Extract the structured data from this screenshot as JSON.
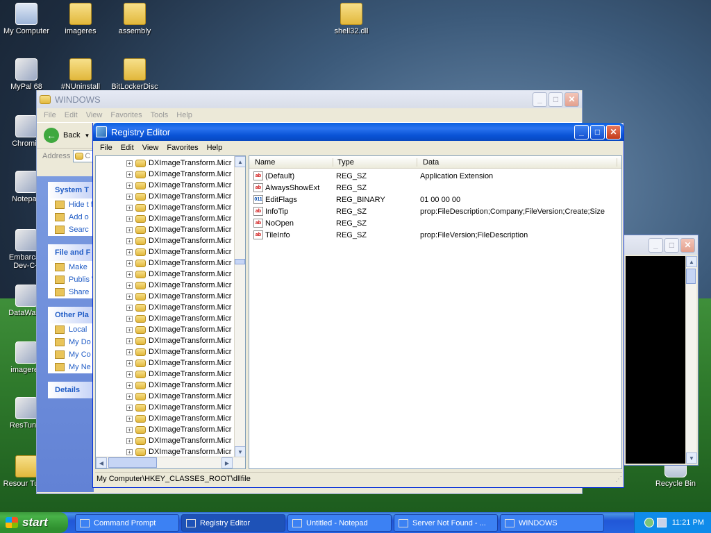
{
  "desktop": {
    "icons": [
      {
        "label": "My Computer",
        "kind": "computer"
      },
      {
        "label": "imageres",
        "kind": "folder"
      },
      {
        "label": "assembly",
        "kind": "folder"
      },
      {
        "label": "shell32.dll",
        "kind": "folder"
      },
      {
        "label": "MyPal 68",
        "kind": "app"
      },
      {
        "label": "#NUninstall",
        "kind": "folder"
      },
      {
        "label": "BitLockerDisc",
        "kind": "folder"
      },
      {
        "label": "Chromiu",
        "kind": "app"
      },
      {
        "label": "Notepad",
        "kind": "app"
      },
      {
        "label": "Embarcad Dev-C+",
        "kind": "app"
      },
      {
        "label": "DataWago",
        "kind": "app"
      },
      {
        "label": "imageres",
        "kind": "app"
      },
      {
        "label": "ResTuner",
        "kind": "app"
      },
      {
        "label": "Resour Tuner",
        "kind": "folder"
      },
      {
        "label": "Recycle Bin",
        "kind": "bin"
      }
    ]
  },
  "explorer": {
    "title": "WINDOWS",
    "menu": [
      "File",
      "Edit",
      "View",
      "Favorites",
      "Tools",
      "Help"
    ],
    "back_label": "Back",
    "address_label": "Address",
    "address_value": "C",
    "panels": [
      {
        "title": "System T",
        "items": [
          "Hide t folder",
          "Add o",
          "Searc"
        ]
      },
      {
        "title": "File and F",
        "items": [
          "Make",
          "Publis Web",
          "Share"
        ]
      },
      {
        "title": "Other Pla",
        "items": [
          "Local",
          "My Do",
          "My Co",
          "My Ne"
        ]
      },
      {
        "title": "Details",
        "items": []
      }
    ]
  },
  "regedit": {
    "title": "Registry Editor",
    "menu": [
      "File",
      "Edit",
      "View",
      "Favorites",
      "Help"
    ],
    "tree_item": "DXImageTransform.Micr",
    "tree_count": 27,
    "columns": [
      "Name",
      "Type",
      "Data"
    ],
    "values": [
      {
        "name": "(Default)",
        "type": "REG_SZ",
        "data": "Application Extension",
        "icon": "ab"
      },
      {
        "name": "AlwaysShowExt",
        "type": "REG_SZ",
        "data": "",
        "icon": "ab"
      },
      {
        "name": "EditFlags",
        "type": "REG_BINARY",
        "data": "01 00 00 00",
        "icon": "bin"
      },
      {
        "name": "InfoTip",
        "type": "REG_SZ",
        "data": "prop:FileDescription;Company;FileVersion;Create;Size",
        "icon": "ab"
      },
      {
        "name": "NoOpen",
        "type": "REG_SZ",
        "data": "",
        "icon": "ab"
      },
      {
        "name": "TileInfo",
        "type": "REG_SZ",
        "data": "prop:FileVersion;FileDescription",
        "icon": "ab"
      }
    ],
    "status": "My Computer\\HKEY_CLASSES_ROOT\\dllfile"
  },
  "taskbar": {
    "start_label": "start",
    "buttons": [
      {
        "label": "Command Prompt",
        "active": false
      },
      {
        "label": "Registry Editor",
        "active": true
      },
      {
        "label": "Untitled - Notepad",
        "active": false
      },
      {
        "label": "Server Not Found - ...",
        "active": false
      },
      {
        "label": "WINDOWS",
        "active": false
      }
    ],
    "clock": "11:21 PM"
  },
  "colors": {
    "xp_blue": "#0a5fe0",
    "start_green": "#3c9a3c",
    "console_black": "#000000"
  }
}
